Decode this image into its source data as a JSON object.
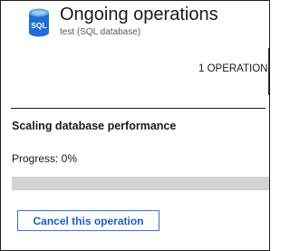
{
  "header": {
    "icon": "sql-database-icon",
    "icon_label": "SQL",
    "title": "Ongoing operations",
    "subtitle": "test (SQL database)"
  },
  "operations": {
    "count_label": "1 OPERATION"
  },
  "operation": {
    "title": "Scaling database performance",
    "progress_label": "Progress: 0%",
    "progress_fraction": 0,
    "cancel_label": "Cancel this operation"
  },
  "colors": {
    "icon_blue": "#1f6fd2",
    "progress_track": "#d3d3d3",
    "progress_fill": "#2a72c8",
    "button_border": "#3576d0",
    "button_text": "#1f5fbf"
  }
}
